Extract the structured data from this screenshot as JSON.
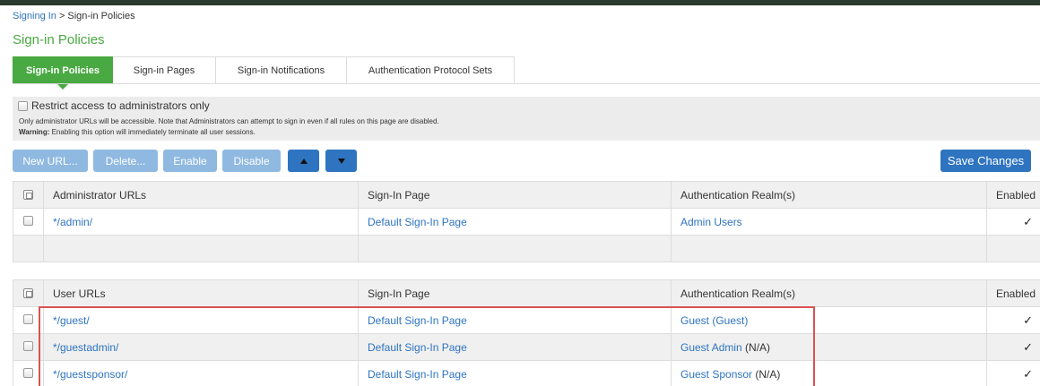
{
  "breadcrumb": {
    "parent": "Signing In",
    "separator": ">",
    "current": "Sign-in Policies"
  },
  "page_title": "Sign-in Policies",
  "tabs": [
    {
      "label": "Sign-in Policies",
      "active": true
    },
    {
      "label": "Sign-in Pages",
      "active": false
    },
    {
      "label": "Sign-in Notifications",
      "active": false
    },
    {
      "label": "Authentication Protocol Sets",
      "active": false
    }
  ],
  "restrict": {
    "checked": false,
    "label": "Restrict access to administrators only",
    "note": "Only administrator URLs will be accessible. Note that Administrators can attempt to sign in even if all rules on this page are disabled.",
    "warning_label": "Warning:",
    "warning_text": " Enabling this option will immediately terminate all user sessions."
  },
  "toolbar": {
    "new_url": "New URL...",
    "delete": "Delete...",
    "enable": "Enable",
    "disable": "Disable",
    "move_up_icon": "arrow-up-icon",
    "move_down_icon": "arrow-down-icon",
    "save_changes": "Save Changes"
  },
  "admin_table": {
    "headers": [
      "Administrator URLs",
      "Sign-In Page",
      "Authentication Realm(s)",
      "Enabled"
    ],
    "rows": [
      {
        "url": "*/admin/",
        "page": "Default Sign-In Page",
        "realm": "Admin Users",
        "realm_note": "",
        "enabled": "✓"
      }
    ]
  },
  "user_table": {
    "headers": [
      "User URLs",
      "Sign-In Page",
      "Authentication Realm(s)",
      "Enabled"
    ],
    "rows": [
      {
        "url": "*/guest/",
        "page": "Default Sign-In Page",
        "realm": "Guest",
        "realm_note": " (Guest)",
        "enabled": "✓"
      },
      {
        "url": "*/guestadmin/",
        "page": "Default Sign-In Page",
        "realm": "Guest Admin",
        "realm_note": " (N/A)",
        "enabled": "✓"
      },
      {
        "url": "*/guestsponsor/",
        "page": "Default Sign-In Page",
        "realm": "Guest Sponsor",
        "realm_note": " (N/A)",
        "enabled": "✓"
      }
    ]
  },
  "colors": {
    "green": "#49a942",
    "blue": "#2e74c0",
    "light_blue": "#8fb9e0",
    "highlight": "#d9534f"
  }
}
